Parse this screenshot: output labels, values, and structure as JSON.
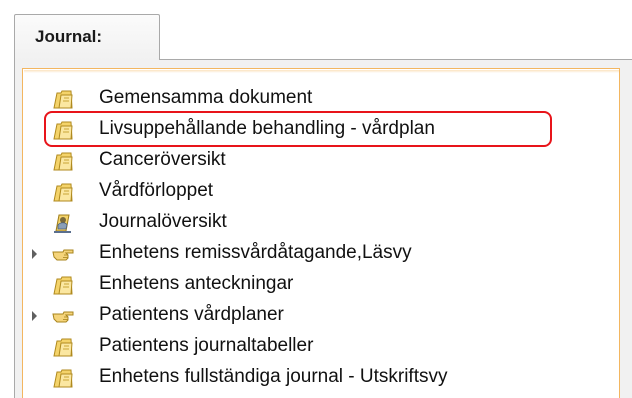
{
  "tab": {
    "label": "Journal:"
  },
  "tree": {
    "items": [
      {
        "label": "Gemensamma dokument",
        "icon": "folder-document-icon",
        "expandable": false
      },
      {
        "label": "Livsuppehållande behandling - vårdplan",
        "icon": "folder-document-icon",
        "expandable": false,
        "highlighted": true
      },
      {
        "label": "Canceröversikt",
        "icon": "folder-document-icon",
        "expandable": false
      },
      {
        "label": "Vårdförloppet",
        "icon": "folder-document-icon",
        "expandable": false
      },
      {
        "label": "Journalöversikt",
        "icon": "journal-overview-icon",
        "expandable": false
      },
      {
        "label": "Enhetens remissvårdåtagande,Läsvy",
        "icon": "hand-pointing-icon",
        "expandable": true
      },
      {
        "label": "Enhetens anteckningar",
        "icon": "folder-document-icon",
        "expandable": false
      },
      {
        "label": "Patientens vårdplaner",
        "icon": "hand-pointing-icon",
        "expandable": true
      },
      {
        "label": "Patientens journaltabeller",
        "icon": "folder-document-icon",
        "expandable": false
      },
      {
        "label": "Enhetens fullständiga journal - Utskriftsvy",
        "icon": "folder-document-icon",
        "expandable": false
      }
    ]
  },
  "colors": {
    "panel_border": "#f3b660",
    "highlight": "#e8141a",
    "folder": "#f2c94c"
  }
}
